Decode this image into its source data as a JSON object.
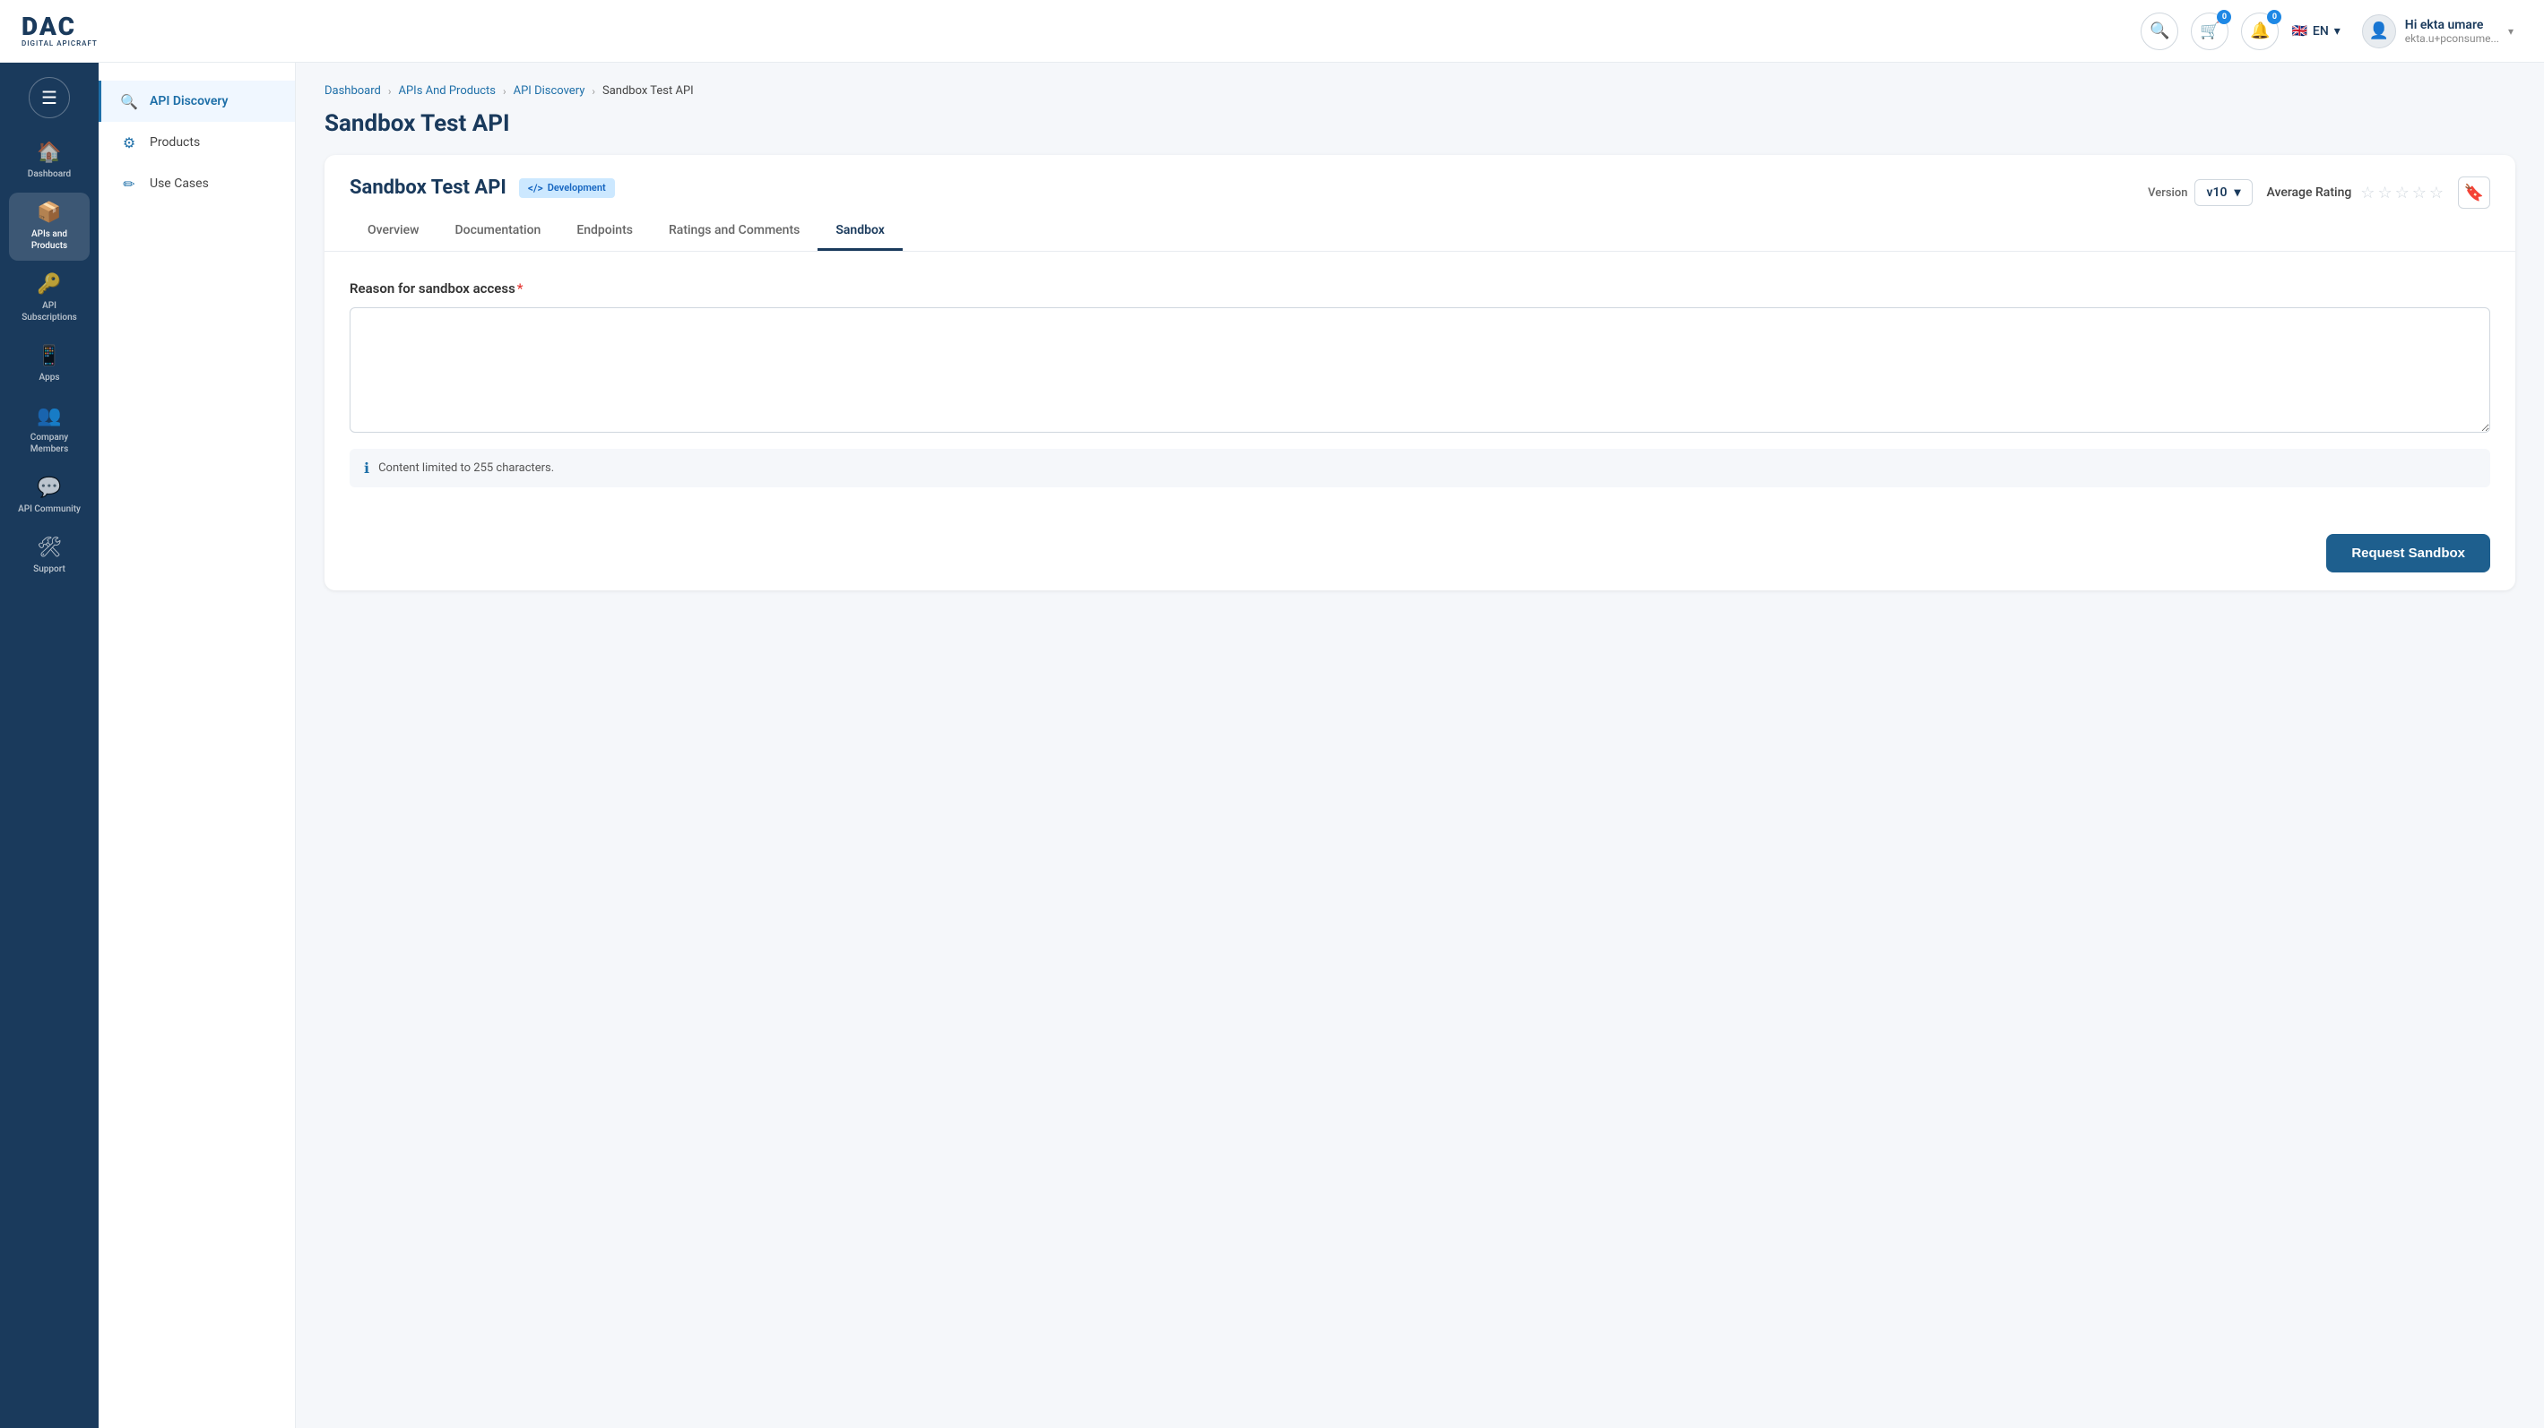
{
  "header": {
    "logo_main": "DAC",
    "logo_sub": "DIGITAL APICRAFT",
    "cart_badge": "0",
    "notification_badge": "0",
    "language": "EN",
    "user_name": "Hi ekta umare",
    "user_email": "ekta.u+pconsume..."
  },
  "sidebar": {
    "items": [
      {
        "id": "dashboard",
        "label": "Dashboard",
        "icon": "🏠"
      },
      {
        "id": "apis-products",
        "label": "APIs and Products",
        "icon": "📦",
        "active": true
      },
      {
        "id": "api-subscriptions",
        "label": "API Subscriptions",
        "icon": "🔑"
      },
      {
        "id": "apps",
        "label": "Apps",
        "icon": "📱"
      },
      {
        "id": "company-members",
        "label": "Company Members",
        "icon": "👥"
      },
      {
        "id": "api-community",
        "label": "API Community",
        "icon": "💬"
      },
      {
        "id": "support",
        "label": "Support",
        "icon": "🛠"
      }
    ]
  },
  "secondary_sidebar": {
    "items": [
      {
        "id": "api-discovery",
        "label": "API Discovery",
        "icon": "🔍",
        "active": true
      },
      {
        "id": "products",
        "label": "Products",
        "icon": "⚙"
      },
      {
        "id": "use-cases",
        "label": "Use Cases",
        "icon": "✏"
      }
    ]
  },
  "breadcrumb": {
    "items": [
      {
        "id": "dashboard",
        "label": "Dashboard"
      },
      {
        "id": "apis-products",
        "label": "APIs And Products"
      },
      {
        "id": "api-discovery",
        "label": "API Discovery"
      },
      {
        "id": "current",
        "label": "Sandbox Test API",
        "current": true
      }
    ]
  },
  "page": {
    "title": "Sandbox Test API"
  },
  "api_card": {
    "title": "Sandbox Test API",
    "badge_label": "Development",
    "badge_icon": "</>",
    "version_label": "Version",
    "version_value": "v10",
    "rating_label": "Average Rating",
    "stars_count": 5,
    "tabs": [
      {
        "id": "overview",
        "label": "Overview"
      },
      {
        "id": "documentation",
        "label": "Documentation"
      },
      {
        "id": "endpoints",
        "label": "Endpoints"
      },
      {
        "id": "ratings-comments",
        "label": "Ratings and Comments"
      },
      {
        "id": "sandbox",
        "label": "Sandbox",
        "active": true
      }
    ],
    "sandbox": {
      "form_label": "Reason for sandbox access",
      "required": true,
      "char_limit_note": "Content limited to 255 characters.",
      "textarea_placeholder": ""
    },
    "request_btn_label": "Request Sandbox"
  }
}
